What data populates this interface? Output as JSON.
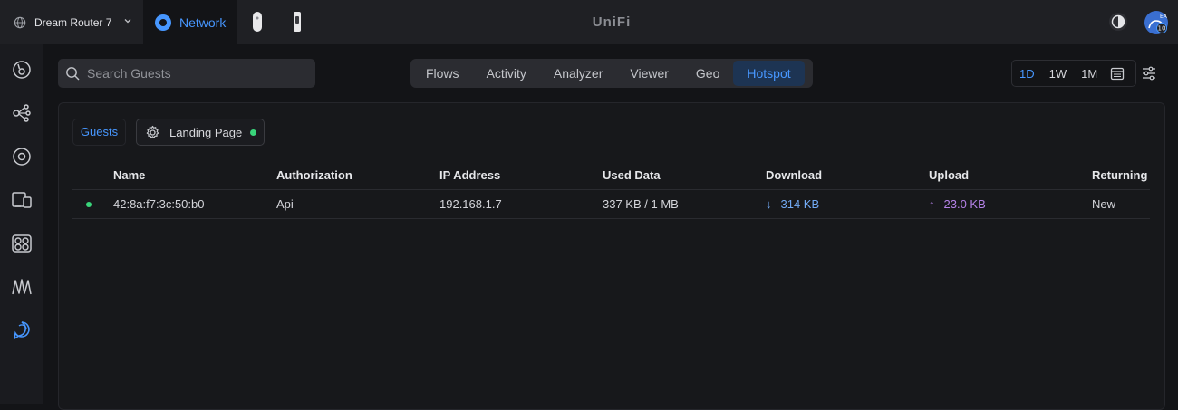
{
  "topbar": {
    "device_name": "Dream Router 7",
    "app_tab": "Network",
    "logo": "UniFi",
    "avatar_badge": "10",
    "avatar_initials": "EA"
  },
  "search": {
    "placeholder": "Search Guests"
  },
  "tabs": [
    {
      "label": "Flows"
    },
    {
      "label": "Activity"
    },
    {
      "label": "Analyzer"
    },
    {
      "label": "Viewer"
    },
    {
      "label": "Geo"
    },
    {
      "label": "Hotspot",
      "active": true
    }
  ],
  "range": {
    "options": [
      "1D",
      "1W",
      "1M"
    ],
    "selected": "1D"
  },
  "subtabs": {
    "guests": "Guests",
    "landing_page": "Landing Page"
  },
  "table": {
    "columns": [
      "Name",
      "Authorization",
      "IP Address",
      "Used Data",
      "Download",
      "Upload",
      "Returning"
    ],
    "rows": [
      {
        "name": "42:8a:f7:3c:50:b0",
        "authorization": "Api",
        "ip": "192.168.1.7",
        "used": "337 KB / 1 MB",
        "download": "314 KB",
        "upload": "23.0 KB",
        "returning": "New"
      }
    ]
  },
  "colors": {
    "accent": "#4797ff",
    "online": "#39d47a",
    "upload": "#b582e8",
    "download": "#72aaf4"
  }
}
